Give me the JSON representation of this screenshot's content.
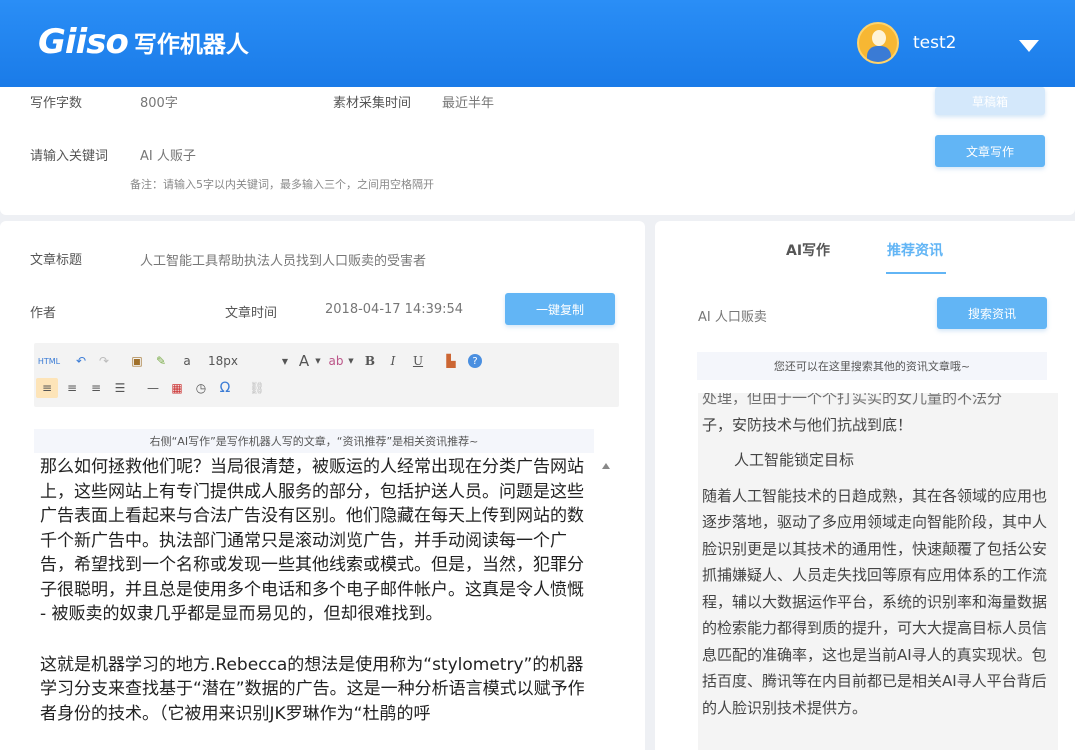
{
  "header": {
    "logo_mark": "Giiso",
    "logo_text": "写作机器人",
    "username": "test2"
  },
  "form": {
    "word_count_label": "写作字数",
    "word_count_value": "800字",
    "collect_time_label": "素材采集时间",
    "collect_time_value": "最近半年",
    "draft_button": "草稿箱",
    "keyword_label": "请输入关键词",
    "keyword_value": "AI  人贩子",
    "write_button": "文章写作",
    "note": "备注：请输入5字以内关键词，最多输入三个，之间用空格隔开"
  },
  "article_meta": {
    "title_label": "文章标题",
    "title_value": "人工智能工具帮助执法人员找到人口贩卖的受害者",
    "author_label": "作者",
    "time_label": "文章时间",
    "time_value": "2018-04-17 14:39:54",
    "copy_button": "一键复制"
  },
  "toolbar": {
    "html": "HTML",
    "font_size": "18px",
    "font_color": "A",
    "bold": "B",
    "italic": "I",
    "underline": "U",
    "omega": "Ω"
  },
  "editor": {
    "hint": "右侧“AI写作”是写作机器人写的文章，“资讯推荐”是相关资讯推荐~",
    "paragraph1": "那么如何拯救他们呢？当局很清楚，被贩运的人经常出现在分类广告网站上，这些网站上有专门提供成人服务的部分，包括护送人员。问题是这些广告表面上看起来与合法广告没有区别。他们隐藏在每天上传到网站的数千个新广告中。执法部门通常只是滚动浏览广告，并手动阅读每一个广告，希望找到一个名称或发现一些其他线索或模式。但是，当然，犯罪分子很聪明，并且总是使用多个电话和多个电子邮件帐户。这真是令人愤慨 - 被贩卖的奴隶几乎都是显而易见的，但却很难找到。",
    "paragraph2": "这就是机器学习的地方.Rebecca的想法是使用称为“stylometry”的机器学习分支来查找基于“潜在”数据的广告。这是一种分析语言模式以赋予作者身份的技术。（它被用来识别JK罗琳作为“杜鹃的呼"
  },
  "right": {
    "tab_ai": "AI写作",
    "tab_news": "推荐资讯",
    "search_value": "AI 人口贩卖",
    "search_button": "搜索资讯",
    "hint": "您还可以在这里搜索其他的资讯文章哦~",
    "line_top": "处理，但由于一个个打实实的女儿量的不法分",
    "line1": "子，安防技术与他们抗战到底！",
    "heading": "人工智能锁定目标",
    "body": "随着人工智能技术的日趋成熟，其在各领域的应用也逐步落地，驱动了多应用领域走向智能阶段，其中人脸识别更是以其技术的通用性，快速颠覆了包括公安抓捕嫌疑人、人员走失找回等原有应用体系的工作流程，辅以大数据运作平台，系统的识别率和海量数据的检索能力都得到质的提升，可大大提高目标人员信息匹配的准确率，这也是当前AI寻人的真实现状。包括百度、腾讯等在内目前都已是相关AI寻人平台背后的人脸识别技术提供方。"
  }
}
